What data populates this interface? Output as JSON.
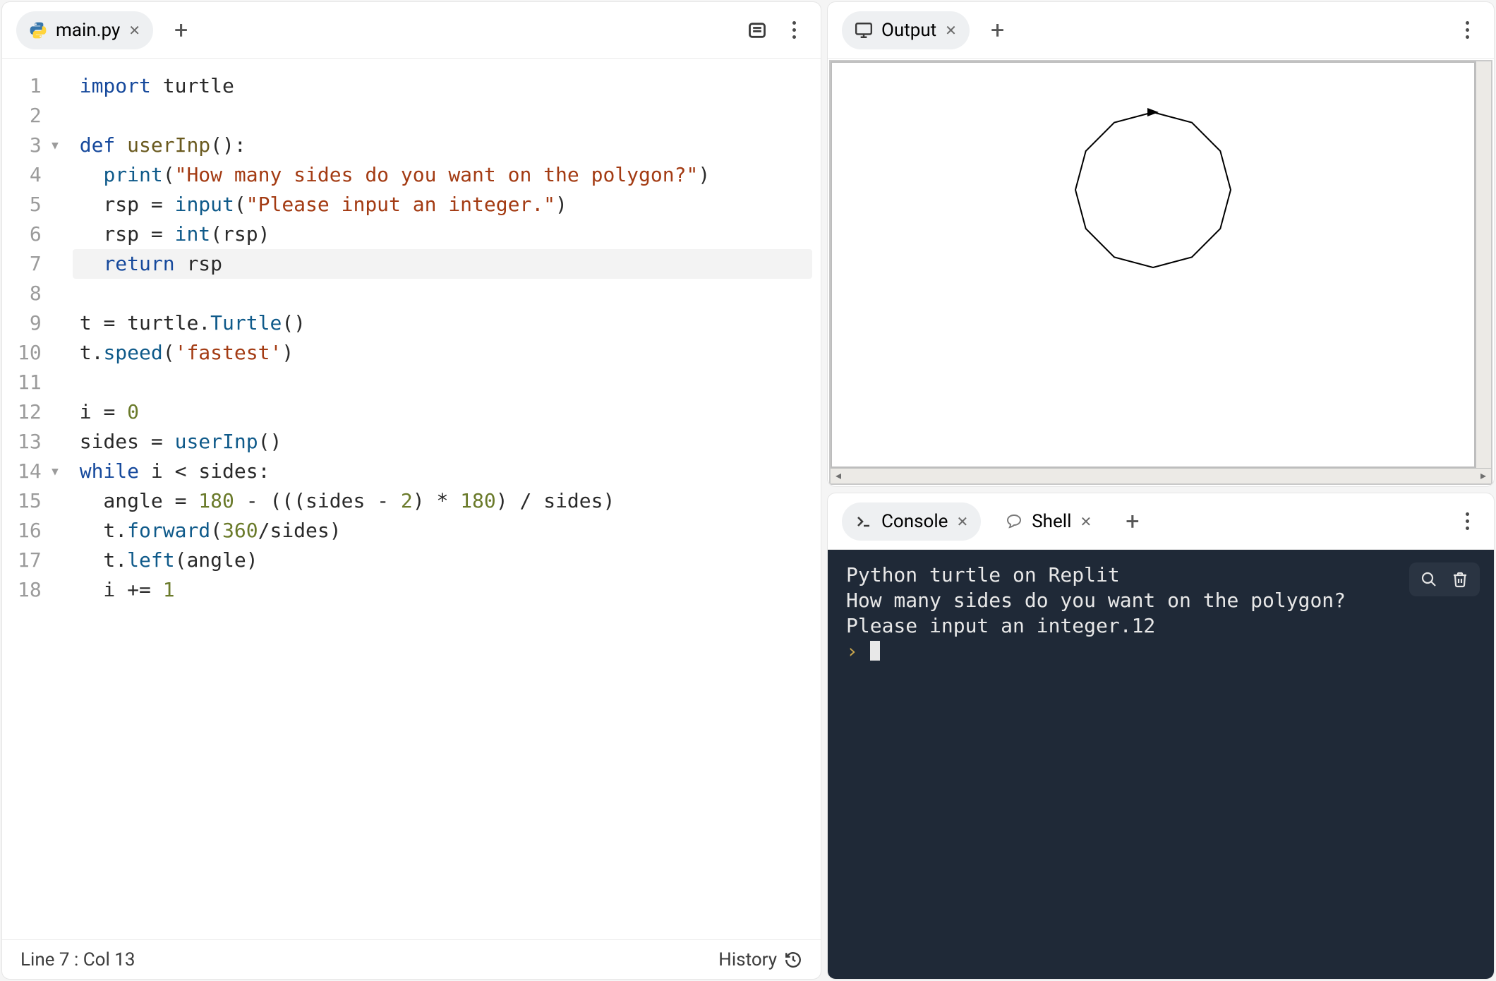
{
  "editor": {
    "tab": {
      "filename": "main.py"
    },
    "status": {
      "pos": "Line 7 : Col 13",
      "history": "History"
    },
    "current_line": 7,
    "fold_lines": [
      3,
      14
    ],
    "lines": [
      {
        "n": 1,
        "tokens": [
          {
            "t": "import ",
            "c": "k-import"
          },
          {
            "t": "turtle",
            "c": "ident"
          }
        ]
      },
      {
        "n": 2,
        "tokens": []
      },
      {
        "n": 3,
        "tokens": [
          {
            "t": "def ",
            "c": "k-def"
          },
          {
            "t": "userInp",
            "c": "fn"
          },
          {
            "t": "():",
            "c": "punct"
          }
        ]
      },
      {
        "n": 4,
        "tokens": [
          {
            "t": "  ",
            "c": ""
          },
          {
            "t": "print",
            "c": "fn-call"
          },
          {
            "t": "(",
            "c": "punct"
          },
          {
            "t": "\"How many sides do you want on the polygon?\"",
            "c": "str"
          },
          {
            "t": ")",
            "c": "punct"
          }
        ]
      },
      {
        "n": 5,
        "tokens": [
          {
            "t": "  rsp ",
            "c": "ident"
          },
          {
            "t": "= ",
            "c": "punct"
          },
          {
            "t": "input",
            "c": "fn-call"
          },
          {
            "t": "(",
            "c": "punct"
          },
          {
            "t": "\"Please input an integer.\"",
            "c": "str"
          },
          {
            "t": ")",
            "c": "punct"
          }
        ]
      },
      {
        "n": 6,
        "tokens": [
          {
            "t": "  rsp ",
            "c": "ident"
          },
          {
            "t": "= ",
            "c": "punct"
          },
          {
            "t": "int",
            "c": "fn-call"
          },
          {
            "t": "(rsp)",
            "c": "punct"
          }
        ]
      },
      {
        "n": 7,
        "tokens": [
          {
            "t": "  ",
            "c": ""
          },
          {
            "t": "return ",
            "c": "k-return"
          },
          {
            "t": "rsp",
            "c": "ident"
          }
        ]
      },
      {
        "n": 8,
        "tokens": []
      },
      {
        "n": 9,
        "tokens": [
          {
            "t": "t ",
            "c": "ident"
          },
          {
            "t": "= ",
            "c": "punct"
          },
          {
            "t": "turtle",
            "c": "ident"
          },
          {
            "t": ".",
            "c": "punct"
          },
          {
            "t": "Turtle",
            "c": "fn-call"
          },
          {
            "t": "()",
            "c": "punct"
          }
        ]
      },
      {
        "n": 10,
        "tokens": [
          {
            "t": "t",
            "c": "ident"
          },
          {
            "t": ".",
            "c": "punct"
          },
          {
            "t": "speed",
            "c": "fn-call"
          },
          {
            "t": "(",
            "c": "punct"
          },
          {
            "t": "'fastest'",
            "c": "str"
          },
          {
            "t": ")",
            "c": "punct"
          }
        ]
      },
      {
        "n": 11,
        "tokens": []
      },
      {
        "n": 12,
        "tokens": [
          {
            "t": "i ",
            "c": "ident"
          },
          {
            "t": "= ",
            "c": "punct"
          },
          {
            "t": "0",
            "c": "num"
          }
        ]
      },
      {
        "n": 13,
        "tokens": [
          {
            "t": "sides ",
            "c": "ident"
          },
          {
            "t": "= ",
            "c": "punct"
          },
          {
            "t": "userInp",
            "c": "fn-call"
          },
          {
            "t": "()",
            "c": "punct"
          }
        ]
      },
      {
        "n": 14,
        "tokens": [
          {
            "t": "while ",
            "c": "k-while"
          },
          {
            "t": "i ",
            "c": "ident"
          },
          {
            "t": "< ",
            "c": "punct"
          },
          {
            "t": "sides",
            "c": "ident"
          },
          {
            "t": ":",
            "c": "punct"
          }
        ]
      },
      {
        "n": 15,
        "tokens": [
          {
            "t": "  angle ",
            "c": "ident"
          },
          {
            "t": "= ",
            "c": "punct"
          },
          {
            "t": "180",
            "c": "num"
          },
          {
            "t": " - ((",
            "c": "punct"
          },
          {
            "t": "(",
            "c": "punct"
          },
          {
            "t": "sides ",
            "c": "ident"
          },
          {
            "t": "- ",
            "c": "punct"
          },
          {
            "t": "2",
            "c": "num"
          },
          {
            "t": ") * ",
            "c": "punct"
          },
          {
            "t": "180",
            "c": "num"
          },
          {
            "t": ") / ",
            "c": "punct"
          },
          {
            "t": "sides",
            "c": "ident"
          },
          {
            "t": ")",
            "c": "punct"
          }
        ]
      },
      {
        "n": 16,
        "tokens": [
          {
            "t": "  t",
            "c": "ident"
          },
          {
            "t": ".",
            "c": "punct"
          },
          {
            "t": "forward",
            "c": "fn-call"
          },
          {
            "t": "(",
            "c": "punct"
          },
          {
            "t": "360",
            "c": "num"
          },
          {
            "t": "/",
            "c": "punct"
          },
          {
            "t": "sides",
            "c": "ident"
          },
          {
            "t": ")",
            "c": "punct"
          }
        ]
      },
      {
        "n": 17,
        "tokens": [
          {
            "t": "  t",
            "c": "ident"
          },
          {
            "t": ".",
            "c": "punct"
          },
          {
            "t": "left",
            "c": "fn-call"
          },
          {
            "t": "(",
            "c": "punct"
          },
          {
            "t": "angle",
            "c": "ident"
          },
          {
            "t": ")",
            "c": "punct"
          }
        ]
      },
      {
        "n": 18,
        "tokens": [
          {
            "t": "  i ",
            "c": "ident"
          },
          {
            "t": "+= ",
            "c": "punct"
          },
          {
            "t": "1",
            "c": "num"
          }
        ]
      }
    ]
  },
  "output": {
    "tab": "Output",
    "polygon_sides": 12
  },
  "console": {
    "tabs": {
      "console": "Console",
      "shell": "Shell"
    },
    "lines": [
      "Python turtle on Replit",
      "How many sides do you want on the polygon?",
      "Please input an integer.12"
    ],
    "prompt": ""
  }
}
